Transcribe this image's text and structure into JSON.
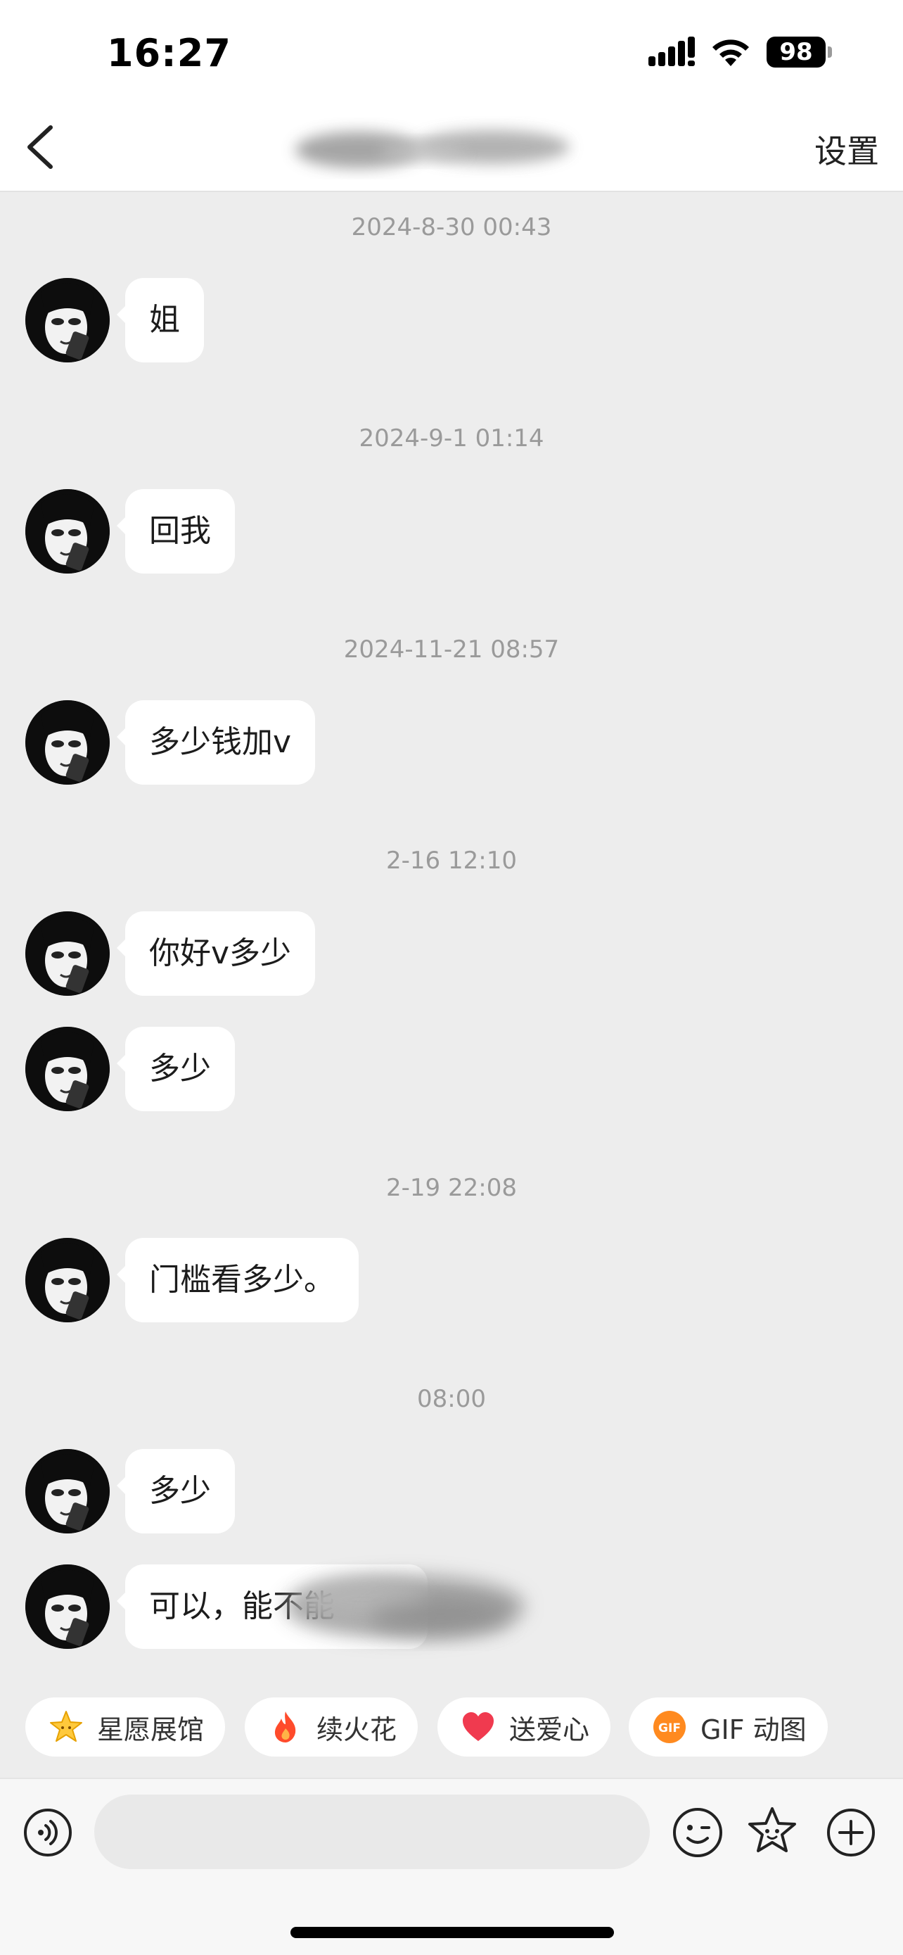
{
  "status_bar": {
    "time": "16:27",
    "battery": "98"
  },
  "nav": {
    "settings_label": "设置"
  },
  "messages": [
    {
      "timestamp": "2024-8-30 00:43",
      "text": "姐"
    },
    {
      "timestamp": "2024-9-1 01:14",
      "text": "回我"
    },
    {
      "timestamp": "2024-11-21 08:57",
      "text": "多少钱加v"
    },
    {
      "timestamp": "2-16 12:10",
      "text": "你好v多少"
    },
    {
      "text": "多少"
    },
    {
      "timestamp": "2-19 22:08",
      "text": "门槛看多少。"
    },
    {
      "timestamp": "08:00",
      "text": "多少"
    },
    {
      "text": "可以，能不能"
    }
  ],
  "quick_actions": [
    {
      "label": "星愿展馆",
      "icon": "star-icon"
    },
    {
      "label": "续火花",
      "icon": "fire-icon"
    },
    {
      "label": "送爱心",
      "icon": "heart-icon"
    },
    {
      "label": "GIF 动图",
      "icon": "gif-icon"
    }
  ],
  "input": {
    "placeholder": ""
  },
  "colors": {
    "background": "#ededed",
    "bubble": "#ffffff",
    "timestamp": "#9a9a9a"
  }
}
